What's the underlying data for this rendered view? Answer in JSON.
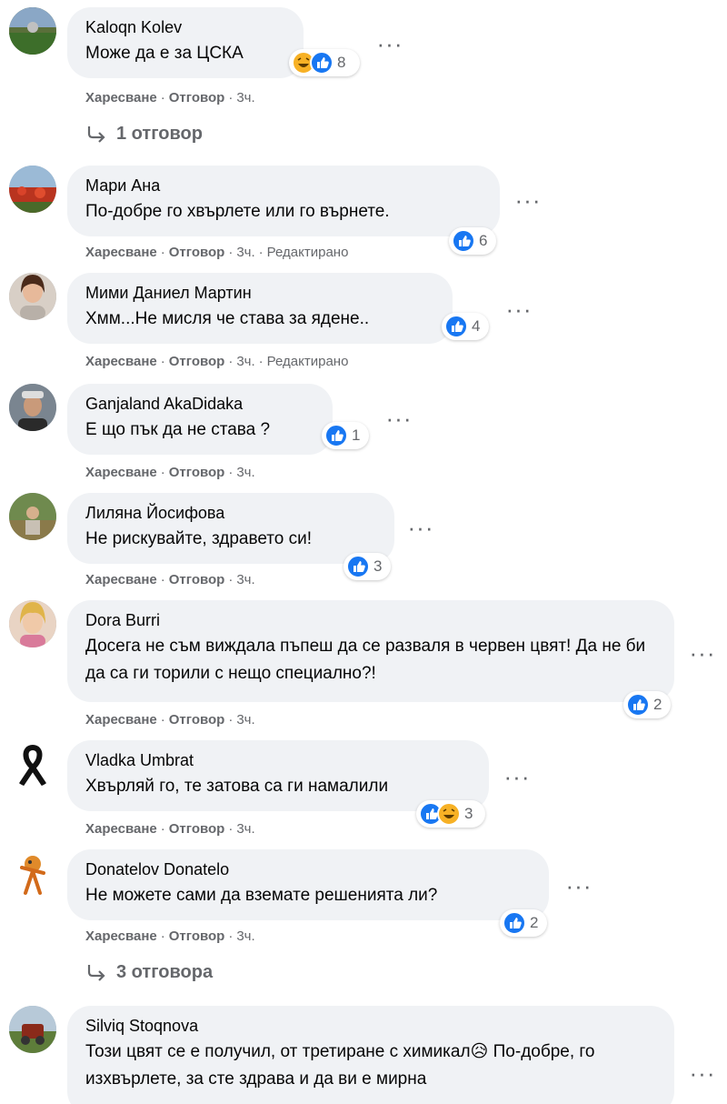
{
  "actions": {
    "like": "Харесване",
    "reply": "Отговор",
    "separator": "·"
  },
  "comments": [
    {
      "author": "Kaloqn Kolev",
      "text": "Може да е за ЦСКА",
      "time": "3ч.",
      "edited": "",
      "reactions": [
        "haha",
        "like"
      ],
      "count": "8",
      "replies": "1 отговор"
    },
    {
      "author": "Мари Ана",
      "text": "По-добре го хвърлете или го върнете.",
      "time": "3ч.",
      "edited": "Редактирано",
      "reactions": [
        "like"
      ],
      "count": "6",
      "replies": ""
    },
    {
      "author": "Мими Даниел Мартин",
      "text": "Хмм...Не мисля че става за ядене..",
      "time": "3ч.",
      "edited": "Редактирано",
      "reactions": [
        "like"
      ],
      "count": "4",
      "replies": ""
    },
    {
      "author": "Ganjaland AkaDidaka",
      "text": "Е що пък да не става ?",
      "time": "3ч.",
      "edited": "",
      "reactions": [
        "like"
      ],
      "count": "1",
      "replies": ""
    },
    {
      "author": "Лиляна Йосифова",
      "text": "Не рискувайте, здравето си!",
      "time": "3ч.",
      "edited": "",
      "reactions": [
        "like"
      ],
      "count": "3",
      "replies": ""
    },
    {
      "author": "Dora Burri",
      "text": "Досега не съм виждала пъпеш да се разваля в червен цвят! Да не би да са ги торили с нещо специално?!",
      "time": "3ч.",
      "edited": "",
      "reactions": [
        "like"
      ],
      "count": "2",
      "replies": ""
    },
    {
      "author": "Vladka Umbrat",
      "text": "Хвърляй го, те затова са ги намалили",
      "time": "3ч.",
      "edited": "",
      "reactions": [
        "like",
        "haha"
      ],
      "count": "3",
      "replies": ""
    },
    {
      "author": "Donatelov Donatelo",
      "text": "Не можете сами да вземате решенията ли?",
      "time": "3ч.",
      "edited": "",
      "reactions": [
        "like"
      ],
      "count": "2",
      "replies": "3 отговора"
    },
    {
      "author": "Silviq Stoqnova",
      "text": "Този цвят се е получил, от третиране с химикал😥 По-добре, го изхвърлете, за сте здрава и да ви е мирна",
      "time": "",
      "edited": "",
      "reactions": [],
      "count": "",
      "replies": ""
    }
  ],
  "colors": {
    "bubble": "#f0f2f5",
    "like_blue": "#1877f2",
    "haha_yellow": "#f7b125",
    "meta_gray": "#65676b"
  },
  "icons": {
    "more": "more-horizontal-icon",
    "reply_arrow": "reply-arrow-icon",
    "like": "like-reaction-icon",
    "haha": "haha-reaction-icon"
  }
}
